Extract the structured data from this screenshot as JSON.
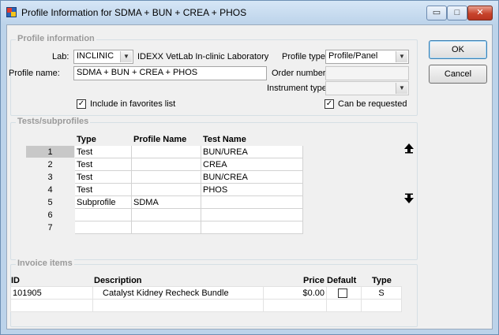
{
  "window": {
    "title": "Profile Information for SDMA + BUN + CREA + PHOS",
    "controls": {
      "minimize": "▭",
      "maximize": "□",
      "close": "✕"
    }
  },
  "profile_information": {
    "caption": "Profile information",
    "lab_label": "Lab:",
    "lab_value": "INCLINIC",
    "lab_description": "IDEXX VetLab In-clinic Laboratory",
    "profile_name_label": "Profile name:",
    "profile_name_value": "SDMA + BUN + CREA + PHOS",
    "include_favorites_label": "Include in favorites list",
    "include_favorites_checked": true,
    "profile_type_label": "Profile type:",
    "profile_type_value": "Profile/Panel",
    "order_number_label": "Order number:",
    "order_number_value": "",
    "instrument_type_label": "Instrument type:",
    "instrument_type_value": "",
    "can_be_requested_label": "Can be requested",
    "can_be_requested_checked": true
  },
  "buttons": {
    "ok": "OK",
    "cancel": "Cancel"
  },
  "tests_subprofiles": {
    "caption": "Tests/subprofiles",
    "columns": [
      "Type",
      "Profile Name",
      "Test Name"
    ],
    "rows": [
      {
        "num": "1",
        "type": "Test",
        "profile_name": "",
        "test_name": "BUN/UREA"
      },
      {
        "num": "2",
        "type": "Test",
        "profile_name": "",
        "test_name": "CREA"
      },
      {
        "num": "3",
        "type": "Test",
        "profile_name": "",
        "test_name": "BUN/CREA"
      },
      {
        "num": "4",
        "type": "Test",
        "profile_name": "",
        "test_name": "PHOS"
      },
      {
        "num": "5",
        "type": "Subprofile",
        "profile_name": "SDMA",
        "test_name": ""
      },
      {
        "num": "6",
        "type": "",
        "profile_name": "",
        "test_name": ""
      },
      {
        "num": "7",
        "type": "",
        "profile_name": "",
        "test_name": ""
      }
    ],
    "move_up_icon": "arrow-up-icon",
    "move_down_icon": "arrow-down-icon"
  },
  "invoice_items": {
    "caption": "Invoice items",
    "columns": {
      "id": "ID",
      "description": "Description",
      "price": "Price",
      "default": "Default",
      "type": "Type"
    },
    "rows": [
      {
        "id": "101905",
        "description": "Catalyst Kidney Recheck Bundle",
        "price": "$0.00",
        "default_checked": false,
        "type": "S"
      }
    ]
  }
}
